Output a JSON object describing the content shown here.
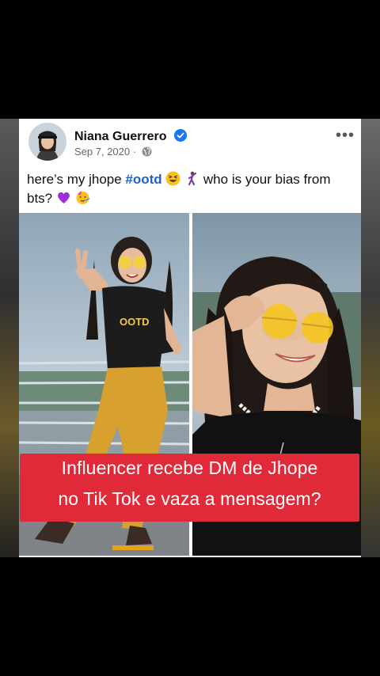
{
  "post": {
    "author": "Niana Guerrero",
    "date": "Sep 7, 2020",
    "date_separator": "·",
    "more_label": "•••",
    "caption": {
      "part1": "here’s my jhope ",
      "hashtag": "#ootd",
      "part2": " who is your bias from bts? "
    },
    "icons": [
      "verified-badge-icon",
      "globe-icon",
      "more-options-icon",
      "grinning-squint-emoji-icon",
      "dancer-emoji-icon",
      "purple-heart-emoji-icon",
      "partying-face-emoji-icon"
    ]
  },
  "overlay": {
    "line1": "Influencer recebe DM de Jhope",
    "line2": "no Tik Tok e vaza a mensagem?"
  },
  "colors": {
    "hashtag": "#1d63c8",
    "verified": "#1877f2",
    "banner": "#e02a3a"
  }
}
